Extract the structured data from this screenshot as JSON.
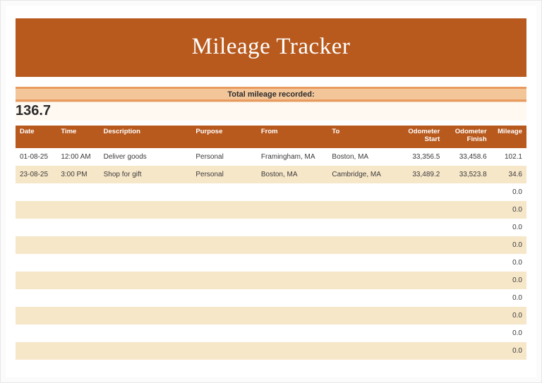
{
  "title": "Mileage Tracker",
  "summary": {
    "label": "Total mileage recorded:",
    "value": "136.7"
  },
  "headers": {
    "date": "Date",
    "time": "Time",
    "description": "Description",
    "purpose": "Purpose",
    "from": "From",
    "to": "To",
    "odometer_start": "Odometer Start",
    "odometer_finish": "Odometer Finish",
    "mileage": "Mileage"
  },
  "rows": [
    {
      "date": "01-08-25",
      "time": "12:00 AM",
      "description": "Deliver goods",
      "purpose": "Personal",
      "from": "Framingham, MA",
      "to": "Boston, MA",
      "odometer_start": "33,356.5",
      "odometer_finish": "33,458.6",
      "mileage": "102.1"
    },
    {
      "date": "23-08-25",
      "time": "3:00 PM",
      "description": "Shop for gift",
      "purpose": "Personal",
      "from": "Boston, MA",
      "to": "Cambridge, MA",
      "odometer_start": "33,489.2",
      "odometer_finish": "33,523.8",
      "mileage": "34.6"
    },
    {
      "date": "",
      "time": "",
      "description": "",
      "purpose": "",
      "from": "",
      "to": "",
      "odometer_start": "",
      "odometer_finish": "",
      "mileage": "0.0"
    },
    {
      "date": "",
      "time": "",
      "description": "",
      "purpose": "",
      "from": "",
      "to": "",
      "odometer_start": "",
      "odometer_finish": "",
      "mileage": "0.0"
    },
    {
      "date": "",
      "time": "",
      "description": "",
      "purpose": "",
      "from": "",
      "to": "",
      "odometer_start": "",
      "odometer_finish": "",
      "mileage": "0.0"
    },
    {
      "date": "",
      "time": "",
      "description": "",
      "purpose": "",
      "from": "",
      "to": "",
      "odometer_start": "",
      "odometer_finish": "",
      "mileage": "0.0"
    },
    {
      "date": "",
      "time": "",
      "description": "",
      "purpose": "",
      "from": "",
      "to": "",
      "odometer_start": "",
      "odometer_finish": "",
      "mileage": "0.0"
    },
    {
      "date": "",
      "time": "",
      "description": "",
      "purpose": "",
      "from": "",
      "to": "",
      "odometer_start": "",
      "odometer_finish": "",
      "mileage": "0.0"
    },
    {
      "date": "",
      "time": "",
      "description": "",
      "purpose": "",
      "from": "",
      "to": "",
      "odometer_start": "",
      "odometer_finish": "",
      "mileage": "0.0"
    },
    {
      "date": "",
      "time": "",
      "description": "",
      "purpose": "",
      "from": "",
      "to": "",
      "odometer_start": "",
      "odometer_finish": "",
      "mileage": "0.0"
    },
    {
      "date": "",
      "time": "",
      "description": "",
      "purpose": "",
      "from": "",
      "to": "",
      "odometer_start": "",
      "odometer_finish": "",
      "mileage": "0.0"
    },
    {
      "date": "",
      "time": "",
      "description": "",
      "purpose": "",
      "from": "",
      "to": "",
      "odometer_start": "",
      "odometer_finish": "",
      "mileage": "0.0"
    }
  ]
}
